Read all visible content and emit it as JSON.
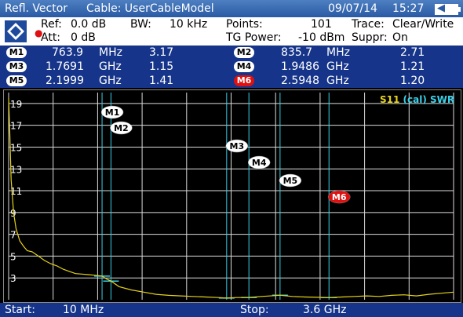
{
  "header": {
    "mode": "Refl. Vector",
    "cable": "Cable: UserCableModel",
    "date": "09/07/14",
    "time": "15:27"
  },
  "settings": {
    "ref_label": "Ref:",
    "ref_value": "0.0 dB",
    "att_label": "Att:",
    "att_value": "0 dB",
    "bw_label": "BW:",
    "bw_value": "10 kHz",
    "points_label": "Points:",
    "points_value": "101",
    "tg_label": "TG Power:",
    "tg_value": "-10 dBm",
    "trace_label": "Trace:",
    "trace_value": "Clear/Write",
    "suppr_label": "Suppr:",
    "suppr_value": "On"
  },
  "markers": [
    {
      "label": "M1",
      "freq": "763.9",
      "unit": "MHz",
      "swr": "3.17",
      "active": false
    },
    {
      "label": "M2",
      "freq": "835.7",
      "unit": "MHz",
      "swr": "2.71",
      "active": false
    },
    {
      "label": "M3",
      "freq": "1.7691",
      "unit": "GHz",
      "swr": "1.15",
      "active": false
    },
    {
      "label": "M4",
      "freq": "1.9486",
      "unit": "GHz",
      "swr": "1.21",
      "active": false
    },
    {
      "label": "M5",
      "freq": "2.1999",
      "unit": "GHz",
      "swr": "1.41",
      "active": false
    },
    {
      "label": "M6",
      "freq": "2.5948",
      "unit": "GHz",
      "swr": "1.20",
      "active": true
    }
  ],
  "chart_data": {
    "type": "line",
    "legend": "S11 (cal) SWR",
    "legend_parts": [
      "S11",
      "(cal)",
      "SWR"
    ],
    "y_ticks": [
      3,
      5,
      7,
      9,
      11,
      13,
      15,
      17,
      19
    ],
    "ylim": [
      1,
      20
    ],
    "xlim_ghz": [
      0.01,
      3.6
    ],
    "grid": true,
    "series": [
      {
        "values_x_ghz": [
          0.01,
          0.02,
          0.03,
          0.05,
          0.07,
          0.1,
          0.13,
          0.16,
          0.2,
          0.25,
          0.3,
          0.35,
          0.4,
          0.45,
          0.5,
          0.55,
          0.6,
          0.65,
          0.7,
          0.764,
          0.8,
          0.836,
          0.9,
          1.0,
          1.1,
          1.2,
          1.3,
          1.4,
          1.5,
          1.6,
          1.7,
          1.769,
          1.85,
          1.949,
          2.05,
          2.2,
          2.3,
          2.4,
          2.5,
          2.595,
          2.7,
          2.8,
          2.9,
          3.0,
          3.1,
          3.2,
          3.3,
          3.4,
          3.5,
          3.6
        ],
        "values_y": [
          19.5,
          16,
          12,
          9,
          7.5,
          6.4,
          5.9,
          5.5,
          5.4,
          5.0,
          4.6,
          4.3,
          4.1,
          3.8,
          3.6,
          3.4,
          3.35,
          3.3,
          3.25,
          3.17,
          2.9,
          2.71,
          2.2,
          1.9,
          1.7,
          1.5,
          1.4,
          1.35,
          1.3,
          1.25,
          1.2,
          1.15,
          1.2,
          1.21,
          1.3,
          1.41,
          1.3,
          1.25,
          1.22,
          1.2,
          1.25,
          1.3,
          1.35,
          1.3,
          1.4,
          1.45,
          1.35,
          1.5,
          1.6,
          1.7
        ]
      }
    ],
    "marker_positions": [
      {
        "label": "M1",
        "x_ghz": 0.7639,
        "y": 3.17
      },
      {
        "label": "M2",
        "x_ghz": 0.8357,
        "y": 2.71
      },
      {
        "label": "M3",
        "x_ghz": 1.7691,
        "y": 1.15
      },
      {
        "label": "M4",
        "x_ghz": 1.9486,
        "y": 1.21
      },
      {
        "label": "M5",
        "x_ghz": 2.1999,
        "y": 1.41
      },
      {
        "label": "M6",
        "x_ghz": 2.5948,
        "y": 1.2
      }
    ]
  },
  "footer": {
    "start_label": "Start:",
    "start_value": "10 MHz",
    "stop_label": "Stop:",
    "stop_value": "3.6 GHz"
  }
}
